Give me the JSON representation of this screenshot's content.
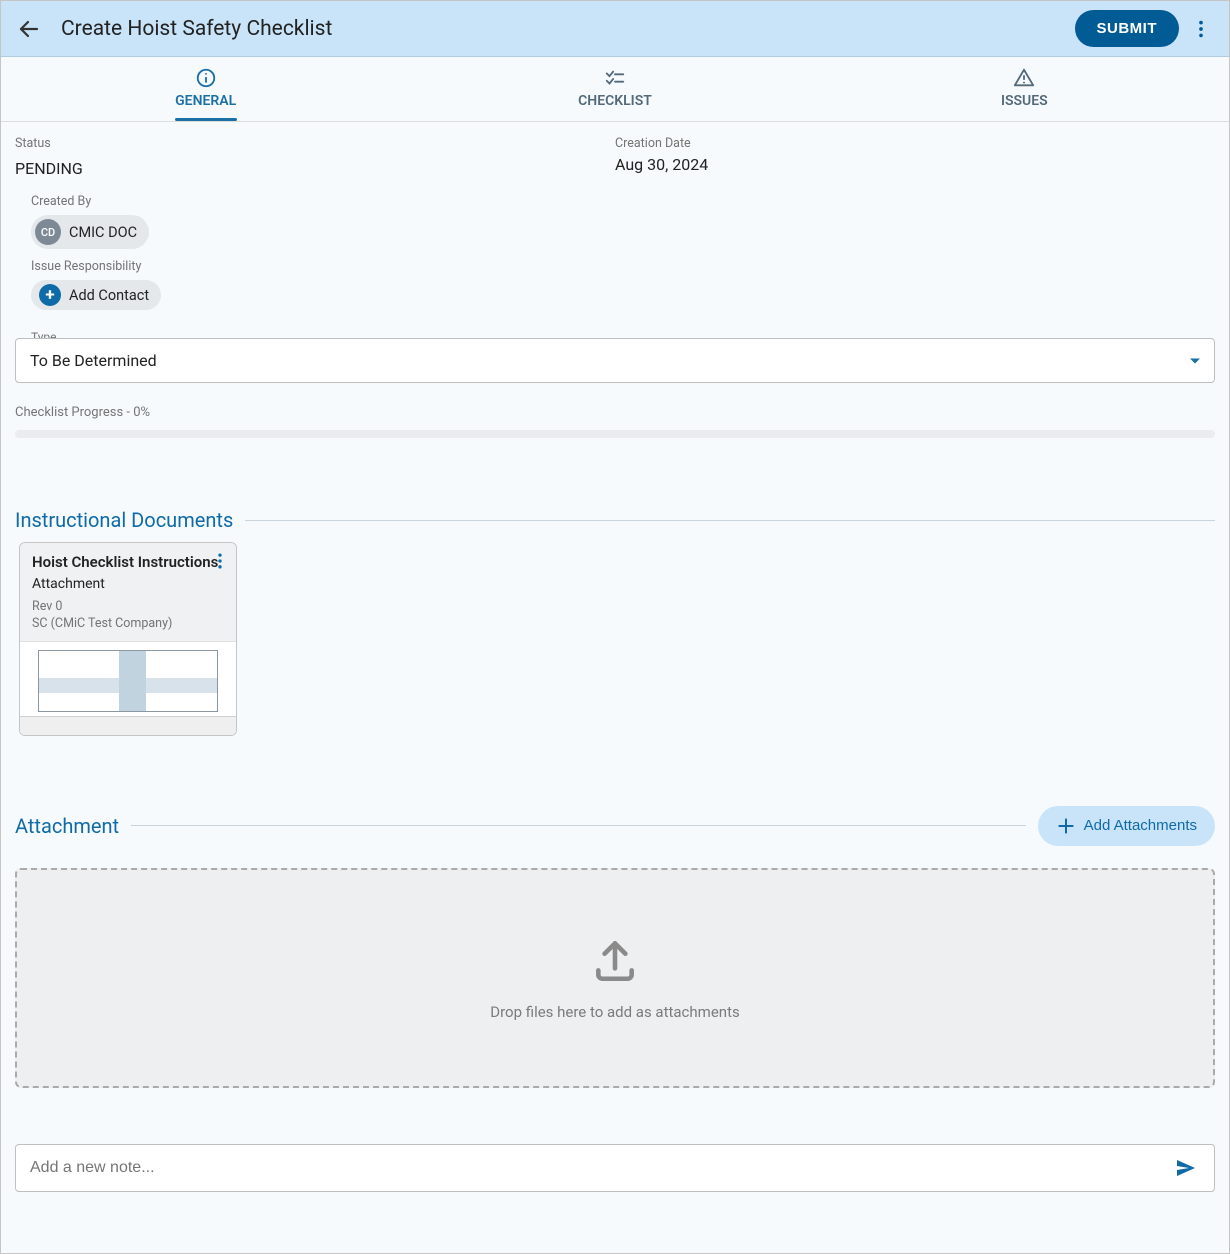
{
  "header": {
    "title": "Create Hoist Safety Checklist",
    "submit_label": "SUBMIT"
  },
  "tabs": {
    "general": "GENERAL",
    "checklist": "CHECKLIST",
    "issues": "ISSUES",
    "active": "general"
  },
  "fields": {
    "status_label": "Status",
    "status_value": "PENDING",
    "creation_date_label": "Creation Date",
    "creation_date_value": "Aug 30, 2024",
    "created_by_label": "Created By",
    "created_by_initials": "CD",
    "created_by_name": "CMIC DOC",
    "issue_resp_label": "Issue Responsibility",
    "add_contact_label": "Add Contact",
    "type_label": "Type",
    "type_value": "To Be Determined"
  },
  "progress": {
    "label": "Checklist Progress - 0%",
    "percent": 0
  },
  "sections": {
    "instructional_title": "Instructional Documents",
    "attachment_title": "Attachment",
    "add_attachments_label": "Add Attachments",
    "dropzone_text": "Drop files here to add as attachments"
  },
  "document": {
    "title": "Hoist Checklist Instructions",
    "subtitle": "Attachment",
    "rev": "Rev 0",
    "owner": "SC (CMiC Test Company)"
  },
  "note": {
    "placeholder": "Add a new note..."
  }
}
